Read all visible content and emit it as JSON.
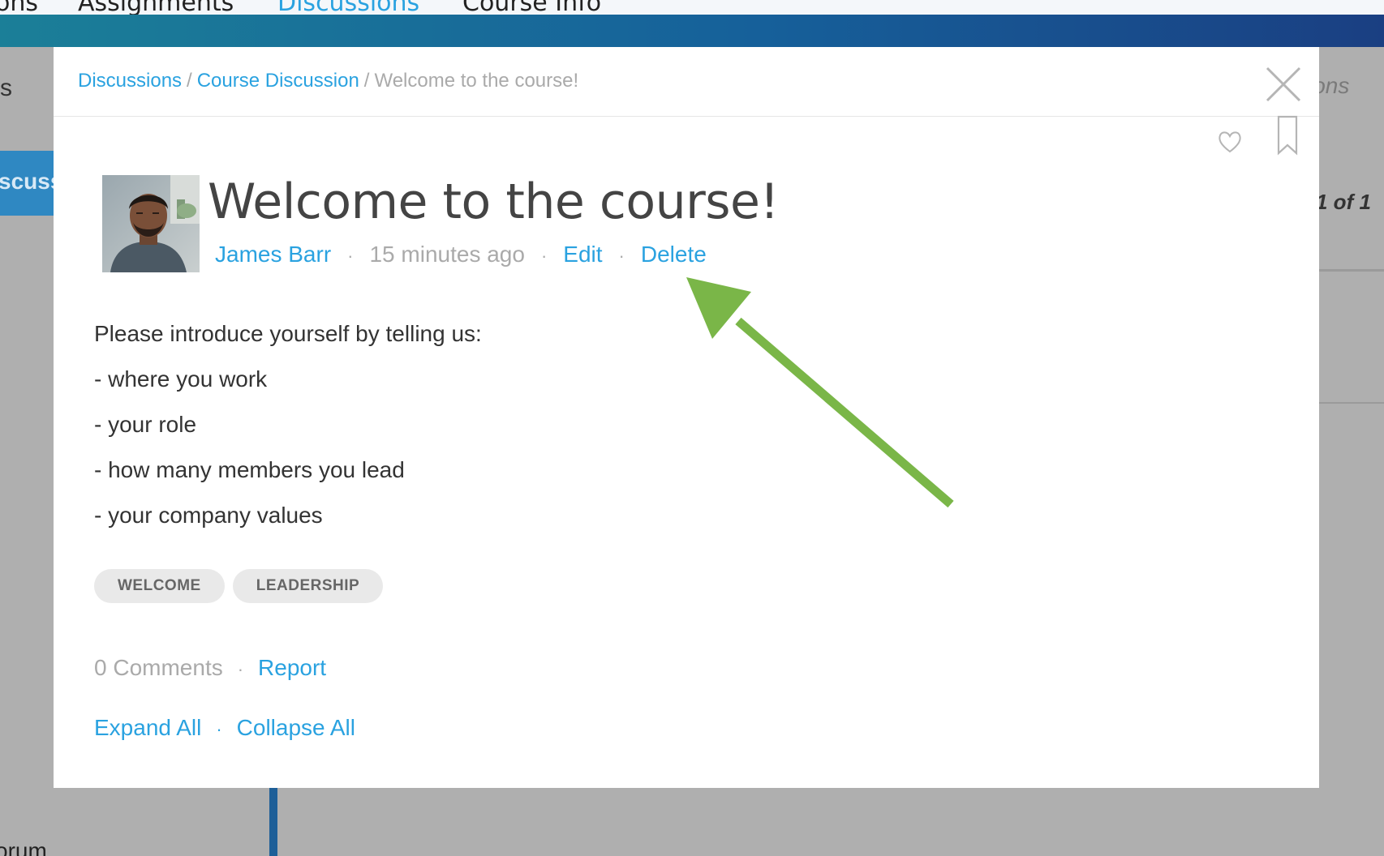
{
  "topnav": {
    "items": [
      "ons",
      "Assignments",
      "Discussions",
      "Course Info"
    ],
    "active_index": 2
  },
  "background": {
    "left_fragment": "s",
    "discuss_button_fragment": "scuss",
    "forum_fragment": "orum",
    "right_fragment": "ions",
    "pagination": "1 of 1"
  },
  "breadcrumb": {
    "items": [
      "Discussions",
      "Course Discussion"
    ],
    "current": "Welcome to the course!",
    "separator": "/"
  },
  "post": {
    "title": "Welcome to the course!",
    "author": "James Barr",
    "time_ago": "15 minutes ago",
    "edit_label": "Edit",
    "delete_label": "Delete",
    "body": [
      "Please introduce yourself by telling us:",
      "- where you work",
      "- your role",
      "- how many members you lead",
      "- your company values"
    ],
    "tags": [
      "WELCOME",
      "LEADERSHIP"
    ],
    "comments_count": "0 Comments",
    "report_label": "Report",
    "expand_all_label": "Expand All",
    "collapse_all_label": "Collapse All"
  },
  "colors": {
    "link": "#2aa2e0",
    "annotation_arrow": "#7ab648",
    "banner_start": "#1b7f98",
    "banner_end": "#1a3f82"
  },
  "icons": [
    "close-icon",
    "heart-icon",
    "bookmark-icon"
  ]
}
